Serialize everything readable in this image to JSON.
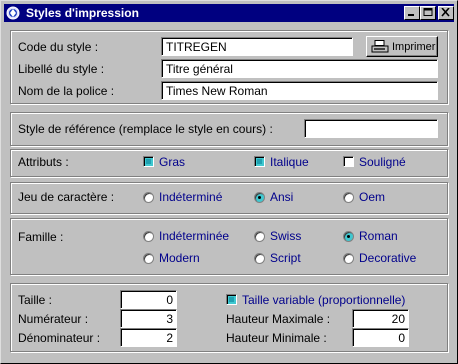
{
  "window": {
    "title": "Styles d'impression"
  },
  "header": {
    "code_label": "Code du style :",
    "code_value": "TITREGEN",
    "libelle_label": "Libellé du style :",
    "libelle_value": "Titre général",
    "police_label": "Nom de la police :",
    "police_value": "Times New Roman",
    "print_button": "Imprimer"
  },
  "reference": {
    "label": "Style de référence (remplace le style en cours) :",
    "value": ""
  },
  "attributs": {
    "label": "Attributs :",
    "items": [
      {
        "label": "Gras",
        "checked": true
      },
      {
        "label": "Italique",
        "checked": true
      },
      {
        "label": "Souligné",
        "checked": false
      }
    ]
  },
  "jeu": {
    "label": "Jeu de caractère :",
    "options": [
      "Indéterminé",
      "Ansi",
      "Oem"
    ],
    "selected": "Ansi"
  },
  "famille": {
    "label": "Famille :",
    "options": [
      "Indéterminée",
      "Swiss",
      "Roman",
      "Modern",
      "Script",
      "Decorative"
    ],
    "selected": "Roman"
  },
  "taille": {
    "taille_label": "Taille :",
    "taille_value": "0",
    "num_label": "Numérateur :",
    "num_value": "3",
    "den_label": "Dénominateur :",
    "den_value": "2",
    "variable_label": "Taille variable (proportionnelle)",
    "variable_checked": true,
    "hmax_label": "Hauteur Maximale :",
    "hmax_value": "20",
    "hmin_label": "Hauteur Minimale :",
    "hmin_value": "0"
  },
  "colors": {
    "titlebar": "#000080",
    "option_text": "#00008b",
    "accent": "#40c8d0"
  }
}
